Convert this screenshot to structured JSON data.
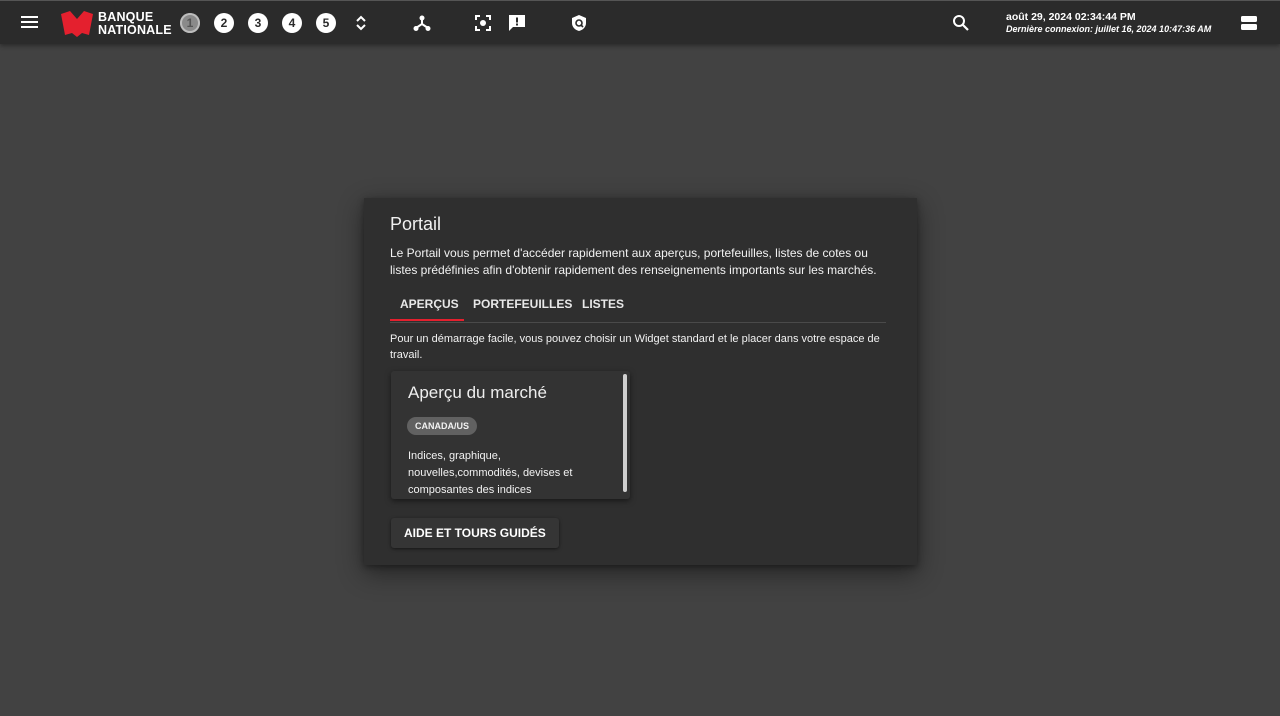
{
  "header": {
    "brand_line1": "BANQUE",
    "brand_line2": "NATIONALE",
    "brand_color": "#e4202e",
    "workspaces": [
      {
        "label": "1",
        "active": true
      },
      {
        "label": "2",
        "active": false
      },
      {
        "label": "3",
        "active": false
      },
      {
        "label": "4",
        "active": false
      },
      {
        "label": "5",
        "active": false
      }
    ],
    "icons": [
      "menu-icon",
      "expand-collapse-icon",
      "network-icon",
      "screenshot-icon",
      "feedback-icon",
      "security-shield-icon",
      "search-icon",
      "profile-toggle-icon"
    ],
    "datetime": "août 29, 2024 02:34:44 PM",
    "last_login": "Dernière connexion: juillet 16, 2024 10:47:36 AM"
  },
  "portal": {
    "title": "Portail",
    "description": "Le Portail vous permet d'accéder rapidement aux aperçus, portefeuilles, listes de cotes ou listes prédéfinies afin d'obtenir rapidement des renseignements importants sur les marchés.",
    "tabs": [
      {
        "label": "APERÇUS",
        "active": true
      },
      {
        "label": "PORTEFEUILLES",
        "active": false
      },
      {
        "label": "LISTES",
        "active": false
      }
    ],
    "tab_description": "Pour un démarrage facile, vous pouvez choisir un Widget standard et le placer dans votre espace de travail.",
    "card": {
      "title": "Aperçu du marché",
      "chip": "CANADA/US",
      "description": "Indices, graphique, nouvelles,commodités, devises et composantes des indices"
    },
    "help_button": "AIDE ET TOURS GUIDÉS"
  }
}
